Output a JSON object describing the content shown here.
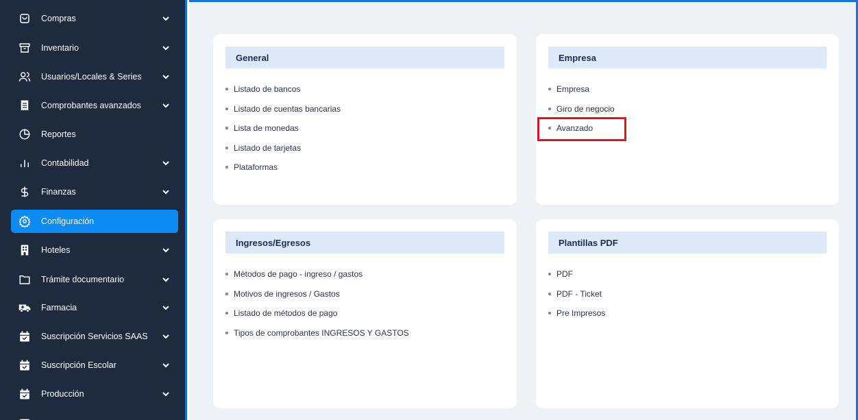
{
  "sidebar": {
    "items": [
      {
        "label": "Compras",
        "icon": "shopping-bag-icon",
        "chevron": true
      },
      {
        "label": "Inventario",
        "icon": "archive-icon",
        "chevron": true
      },
      {
        "label": "Usuarios/Locales & Series",
        "icon": "users-icon",
        "chevron": true
      },
      {
        "label": "Comprobantes avanzados",
        "icon": "receipt-icon",
        "chevron": true
      },
      {
        "label": "Reportes",
        "icon": "pie-chart-icon",
        "chevron": false
      },
      {
        "label": "Contabilidad",
        "icon": "bar-chart-icon",
        "chevron": true
      },
      {
        "label": "Finanzas",
        "icon": "dollar-icon",
        "chevron": true
      },
      {
        "label": "Configuración",
        "icon": "gear-icon",
        "chevron": false,
        "active": true
      },
      {
        "label": "Hoteles",
        "icon": "building-icon",
        "chevron": true
      },
      {
        "label": "Trámite documentario",
        "icon": "folder-icon",
        "chevron": true
      },
      {
        "label": "Farmacia",
        "icon": "ambulance-icon",
        "chevron": true
      },
      {
        "label": "Suscripción Servicios SAAS",
        "icon": "calendar-check-icon",
        "chevron": true
      },
      {
        "label": "Suscripción Escolar",
        "icon": "calendar-check-icon",
        "chevron": true
      },
      {
        "label": "Producción",
        "icon": "calendar-check-icon",
        "chevron": true
      }
    ]
  },
  "cards": {
    "general": {
      "title": "General",
      "items": [
        "Listado de bancos",
        "Listado de cuentas bancarias",
        "Lista de monedas",
        "Listado de tarjetas",
        "Plataformas"
      ]
    },
    "empresa": {
      "title": "Empresa",
      "items": [
        "Empresa",
        "Giro de negocio",
        "Avanzado"
      ]
    },
    "ingresos": {
      "title": "Ingresos/Egresos",
      "items": [
        "Métodos de pago - ingreso / gastos",
        "Motivos de ingresos / Gastos",
        "Listado de métodos de pago",
        "Tipos de comprobantes INGRESOS Y GASTOS"
      ]
    },
    "plantillas": {
      "title": "Plantillas PDF",
      "items": [
        "PDF",
        "PDF - Ticket",
        "Pre Impresos"
      ]
    }
  },
  "colors": {
    "sidebar_bg": "#1e2a3e",
    "active_bg": "#0d8bf2",
    "frame_border": "#1a72d6",
    "main_bg": "#eef2f7",
    "card_header_bg": "#dde9f8",
    "highlight": "#e3121c"
  }
}
